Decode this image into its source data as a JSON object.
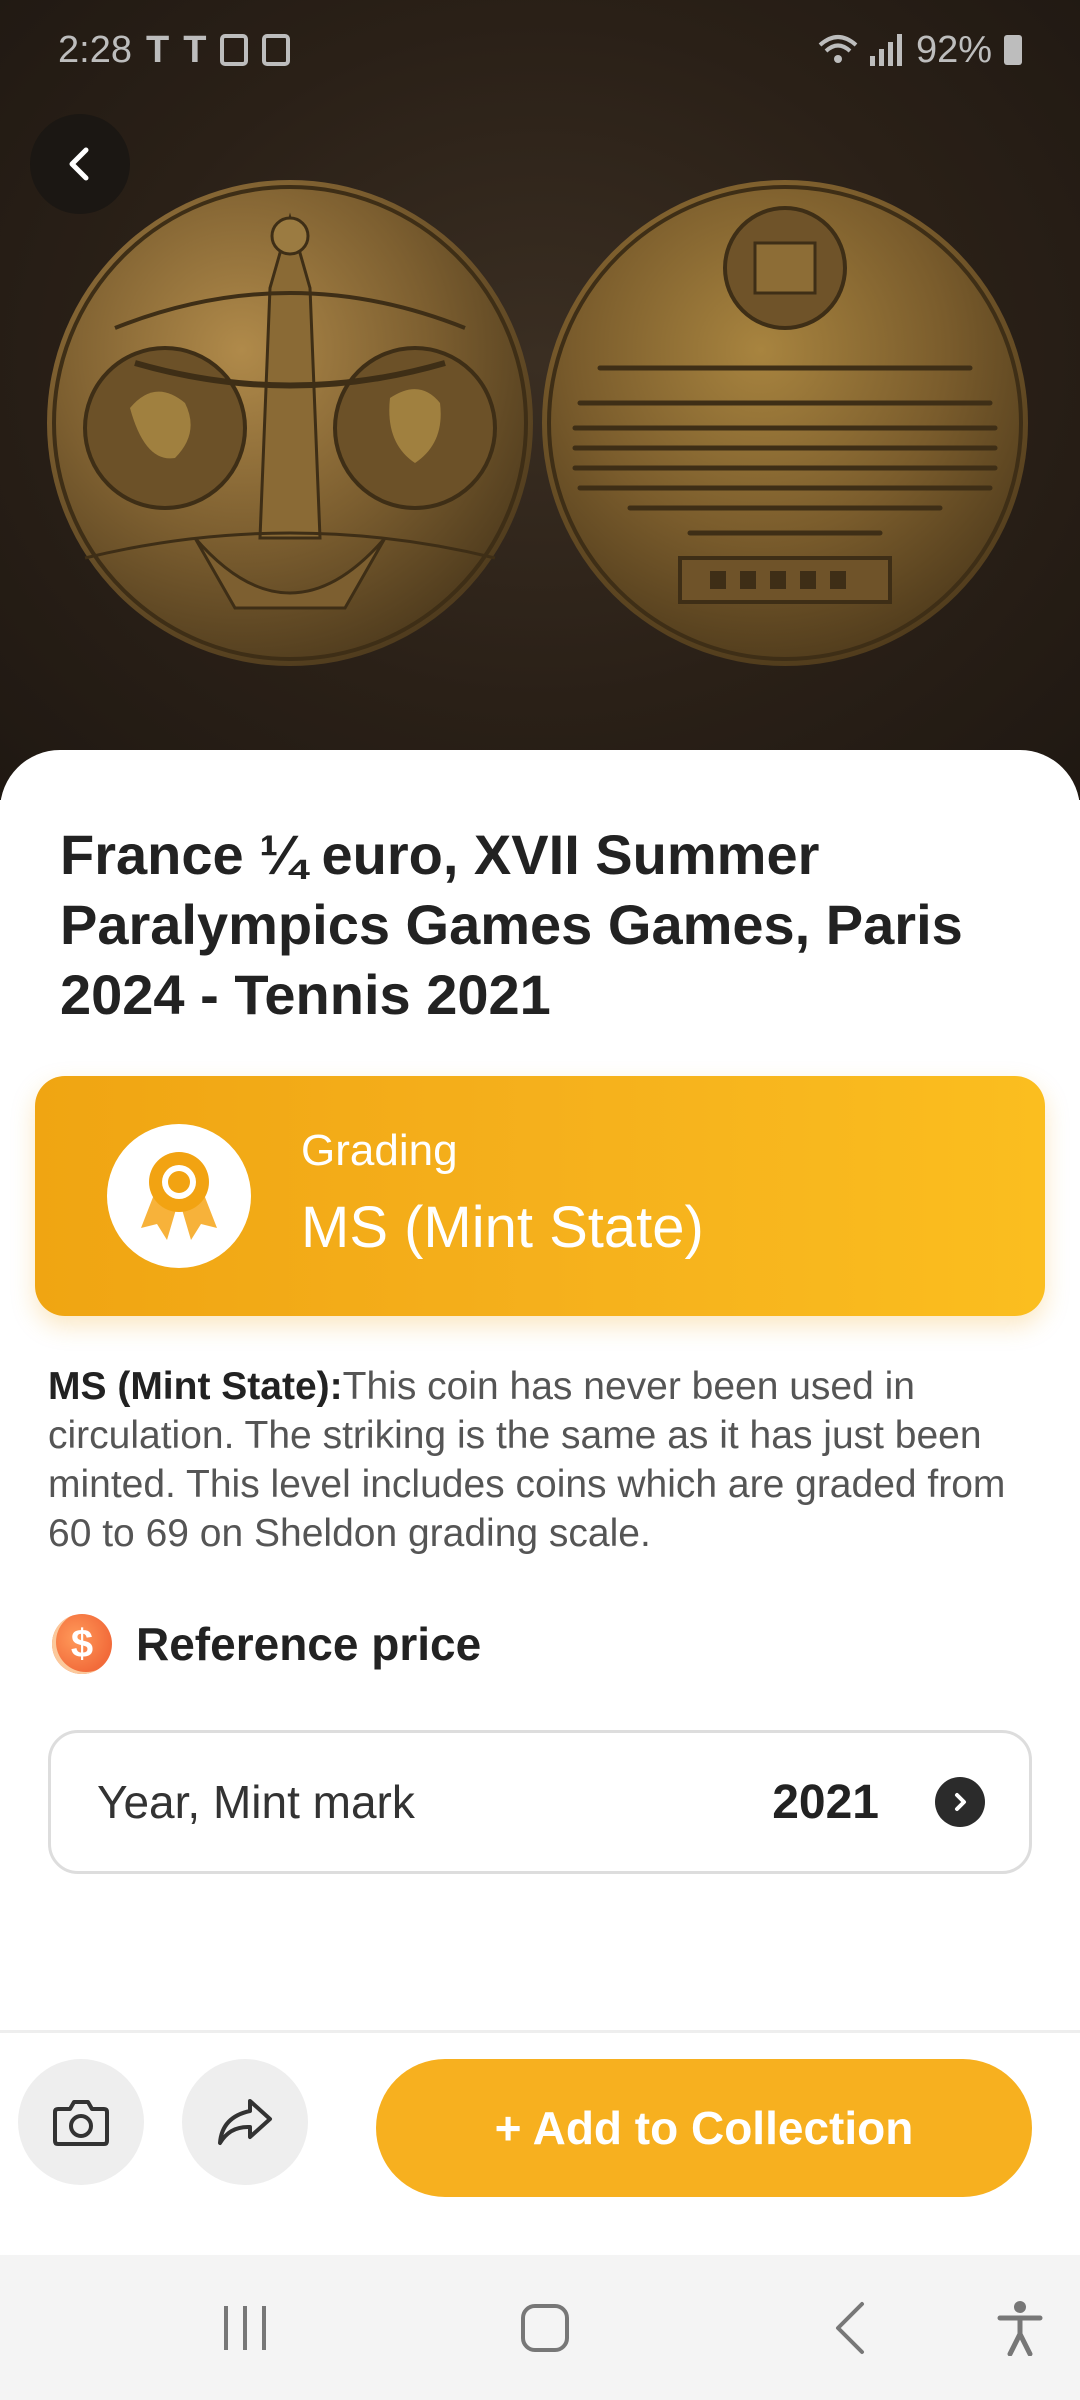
{
  "status_bar": {
    "time": "2:28",
    "battery": "92%"
  },
  "coin": {
    "title": "France ¼ euro, XVII Summer Paralympics Games Games, Paris 2024 - Tennis 2021",
    "image_alt": "Commemorative medal obverse and reverse"
  },
  "grading": {
    "label": "Grading",
    "value": "MS (Mint State)",
    "description_term": "MS (Mint State):",
    "description_text": "This coin has never been used in circulation. The striking is the same as it has just been minted. This level includes coins which are graded from 60 to 69 on Sheldon grading scale."
  },
  "reference_price": {
    "title": "Reference price",
    "icon_glyph": "$",
    "row_label": "Year, Mint mark",
    "row_value": "2021"
  },
  "actions": {
    "add_label": "+ Add to Collection"
  },
  "icons": {
    "back": "back-arrow-icon",
    "camera": "camera-icon",
    "share": "share-icon",
    "award": "award-ribbon-icon",
    "chevron": "chevron-right-icon"
  },
  "colors": {
    "accent": "#f7b01f",
    "grading_start": "#f0a512",
    "grading_end": "#fbbe1f",
    "price_icon": "#f26b3a",
    "hero_bg": "#2a2017"
  }
}
